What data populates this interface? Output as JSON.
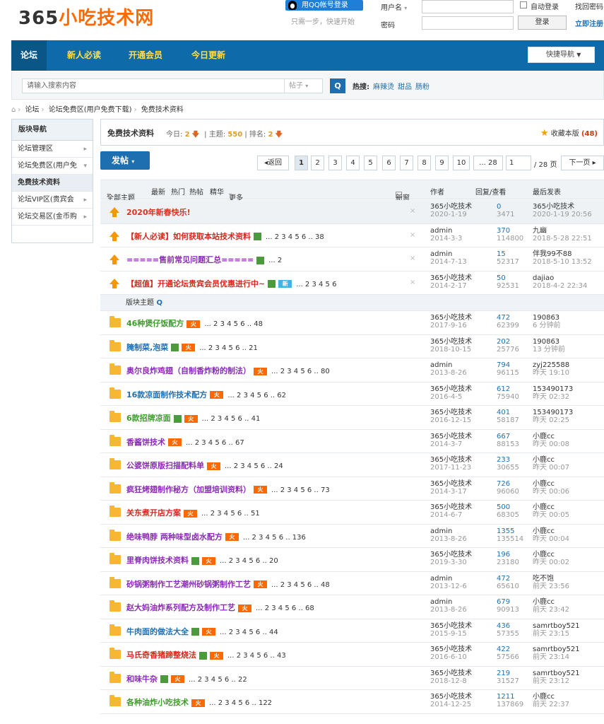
{
  "header": {
    "logo_part1": "365",
    "logo_part2": "小吃技术网",
    "qq_login": "用QQ帐号登录",
    "qq_note": "只需一步，快速开始",
    "username_label": "用户名",
    "password_label": "密码",
    "auto_login": "自动登录",
    "find_password": "找回密码",
    "login_button": "登录",
    "register": "立即注册"
  },
  "nav": {
    "items": [
      "论坛",
      "新人必读",
      "开通会员",
      "今日更新"
    ],
    "quick": "快捷导航"
  },
  "search": {
    "placeholder": "请输入搜索内容",
    "type": "帖子",
    "hot_label": "热搜:",
    "hot": [
      "麻辣烫",
      "甜品",
      "肠粉"
    ]
  },
  "breadcrumb": [
    "论坛",
    "论坛免费区(用户免费下载)",
    "免费技术资料"
  ],
  "sidebar": {
    "title": "版块导航",
    "items": [
      "论坛管理区",
      "论坛免费区(用户免",
      "免费技术资料",
      "论坛VIP区(贵宾会",
      "论坛交易区(金币购"
    ]
  },
  "forum": {
    "name": "免费技术资料",
    "today_label": "今日:",
    "today": "2",
    "topics_label": "主题:",
    "topics": "550",
    "rank_label": "排名:",
    "rank": "2",
    "favorite": "收藏本版",
    "favorite_count": "(48)"
  },
  "toolbar": {
    "post": "发帖",
    "back": "返回",
    "pages": [
      "1",
      "2",
      "3",
      "4",
      "5",
      "6",
      "7",
      "8",
      "9",
      "10",
      "... 28"
    ],
    "page_input": "1",
    "total": "/ 28 页",
    "next": "下一页"
  },
  "table_head": {
    "all": "全部主题",
    "newest": "最新",
    "hot": "热门",
    "hotpost": "热帖",
    "digest": "精华",
    "more": "更多",
    "newwin": "新窗",
    "author": "作者",
    "reply_view": "回复/查看",
    "last_post": "最后发表"
  },
  "section_label": "版块主题",
  "sticky": [
    {
      "title": "2020年新春快乐!",
      "color": "#e0301e",
      "pages": "",
      "img": false,
      "newtag": false,
      "author": "365小吃技术",
      "adate": "2020-1-19",
      "replies": "0",
      "views": "3471",
      "last": "365小吃技术",
      "ldate": "2020-1-19 20:56"
    },
    {
      "title": "【新人必读】如何获取本站技术资料",
      "color": "#d6281d",
      "pages": "... 2 3 4 5 6 .. 38",
      "img": true,
      "newtag": false,
      "author": "admin",
      "adate": "2014-3-3",
      "replies": "370",
      "views": "114800",
      "last": "九幽",
      "ldate": "2018-5-28 22:51"
    },
    {
      "title": "=====售前常见问题汇总=====",
      "color": "#8b2bb9",
      "pages": "... 2",
      "img": true,
      "newtag": false,
      "author": "admin",
      "adate": "2014-7-13",
      "replies": "15",
      "views": "52317",
      "last": "伴我99不88",
      "ldate": "2018-5-10 13:52"
    },
    {
      "title": "【超值】开通论坛贵宾会员优惠进行中~",
      "color": "#d6281d",
      "pages": "... 2 3 4 5 6",
      "img": true,
      "newtag": true,
      "author": "365小吃技术",
      "adate": "2014-2-17",
      "replies": "50",
      "views": "92531",
      "last": "dajiao",
      "ldate": "2018-4-2 22:34"
    }
  ],
  "threads": [
    {
      "title": "46种煲仔饭配方",
      "color": "#3e9b2c",
      "pages": "... 2 3 4 5 6 .. 48",
      "img": false,
      "author": "365小吃技术",
      "adate": "2017-9-16",
      "replies": "472",
      "views": "62399",
      "last": "190863",
      "ldate": "6 分钟前"
    },
    {
      "title": "腌制菜,泡菜",
      "color": "#1f6fb2",
      "pages": "... 2 3 4 5 6 .. 21",
      "img": true,
      "author": "365小吃技术",
      "adate": "2018-10-15",
      "replies": "202",
      "views": "25776",
      "last": "190863",
      "ldate": "13 分钟前"
    },
    {
      "title": "奥尔良炸鸡翅（自制香炸粉的制法）",
      "color": "#8b2bb9",
      "pages": "... 2 3 4 5 6 .. 80",
      "img": false,
      "author": "admin",
      "adate": "2013-8-26",
      "replies": "794",
      "views": "96115",
      "last": "zyj225588",
      "ldate": "昨天 19:10"
    },
    {
      "title": "16款凉面制作技术配方",
      "color": "#1f6fb2",
      "pages": "... 2 3 4 5 6 .. 62",
      "img": false,
      "author": "365小吃技术",
      "adate": "2016-4-5",
      "replies": "612",
      "views": "75940",
      "last": "153490173",
      "ldate": "昨天 02:32"
    },
    {
      "title": "6款招牌凉面",
      "color": "#3e9b2c",
      "pages": "... 2 3 4 5 6 .. 41",
      "img": true,
      "author": "365小吃技术",
      "adate": "2016-12-15",
      "replies": "401",
      "views": "58187",
      "last": "153490173",
      "ldate": "昨天 02:25"
    },
    {
      "title": "香酱饼技术",
      "color": "#8b2bb9",
      "pages": "... 2 3 4 5 6 .. 67",
      "img": false,
      "author": "365小吃技术",
      "adate": "2014-3-7",
      "replies": "667",
      "views": "88153",
      "last": "小鹿cc",
      "ldate": "昨天 00:08"
    },
    {
      "title": "公婆饼原版扫描配料单",
      "color": "#8b2bb9",
      "pages": "... 2 3 4 5 6 .. 24",
      "img": false,
      "author": "365小吃技术",
      "adate": "2017-11-23",
      "replies": "233",
      "views": "30655",
      "last": "小鹿cc",
      "ldate": "昨天 00:07"
    },
    {
      "title": "疯狂烤翅制作秘方（加盟培训资料）",
      "color": "#8b2bb9",
      "pages": "... 2 3 4 5 6 .. 73",
      "img": false,
      "author": "365小吃技术",
      "adate": "2014-3-17",
      "replies": "726",
      "views": "96060",
      "last": "小鹿cc",
      "ldate": "昨天 00:06"
    },
    {
      "title": "关东煮开店方案",
      "color": "#d6281d",
      "pages": "... 2 3 4 5 6 .. 51",
      "img": false,
      "author": "365小吃技术",
      "adate": "2014-6-7",
      "replies": "500",
      "views": "68305",
      "last": "小鹿cc",
      "ldate": "昨天 00:05"
    },
    {
      "title": "绝味鸭脖 两种味型卤水配方",
      "color": "#8b2bb9",
      "pages": "... 2 3 4 5 6 .. 136",
      "img": false,
      "author": "admin",
      "adate": "2013-8-26",
      "replies": "1355",
      "views": "135514",
      "last": "小鹿cc",
      "ldate": "昨天 00:04"
    },
    {
      "title": "里脊肉饼技术资料",
      "color": "#8b2bb9",
      "pages": "... 2 3 4 5 6 .. 20",
      "img": true,
      "author": "365小吃技术",
      "adate": "2019-3-30",
      "replies": "196",
      "views": "23180",
      "last": "小鹿cc",
      "ldate": "昨天 00:02"
    },
    {
      "title": "砂锅粥制作工艺潮州砂锅粥制作工艺",
      "color": "#8b2bb9",
      "pages": "... 2 3 4 5 6 .. 48",
      "img": false,
      "author": "admin",
      "adate": "2013-12-6",
      "replies": "472",
      "views": "65610",
      "last": "吃不饱",
      "ldate": "前天 23:56"
    },
    {
      "title": "赵大妈油炸系列配方及制作工艺",
      "color": "#8b2bb9",
      "pages": "... 2 3 4 5 6 .. 68",
      "img": false,
      "author": "admin",
      "adate": "2013-8-26",
      "replies": "679",
      "views": "90913",
      "last": "小鹿cc",
      "ldate": "前天 23:42"
    },
    {
      "title": "牛肉面的做法大全",
      "color": "#1f6fb2",
      "pages": "... 2 3 4 5 6 .. 44",
      "img": true,
      "author": "365小吃技术",
      "adate": "2015-9-15",
      "replies": "436",
      "views": "57355",
      "last": "samrtboy521",
      "ldate": "前天 23:15"
    },
    {
      "title": "马氏奇香猪蹄整烧法",
      "color": "#d6281d",
      "pages": "... 2 3 4 5 6 .. 43",
      "img": true,
      "author": "365小吃技术",
      "adate": "2016-6-10",
      "replies": "422",
      "views": "57566",
      "last": "samrtboy521",
      "ldate": "前天 23:14"
    },
    {
      "title": "和味牛杂",
      "color": "#8b2bb9",
      "pages": "... 2 3 4 5 6 .. 22",
      "img": true,
      "author": "365小吃技术",
      "adate": "2018-12-8",
      "replies": "219",
      "views": "31527",
      "last": "samrtboy521",
      "ldate": "前天 23:12"
    },
    {
      "title": "各种油炸小吃技术",
      "color": "#3e9b2c",
      "pages": "... 2 3 4 5 6 .. 122",
      "img": false,
      "author": "365小吃技术",
      "adate": "2014-12-25",
      "replies": "1211",
      "views": "137869",
      "last": "小鹿cc",
      "ldate": "前天 22:37"
    }
  ],
  "tags": {
    "hot": "火",
    "new": "新"
  }
}
